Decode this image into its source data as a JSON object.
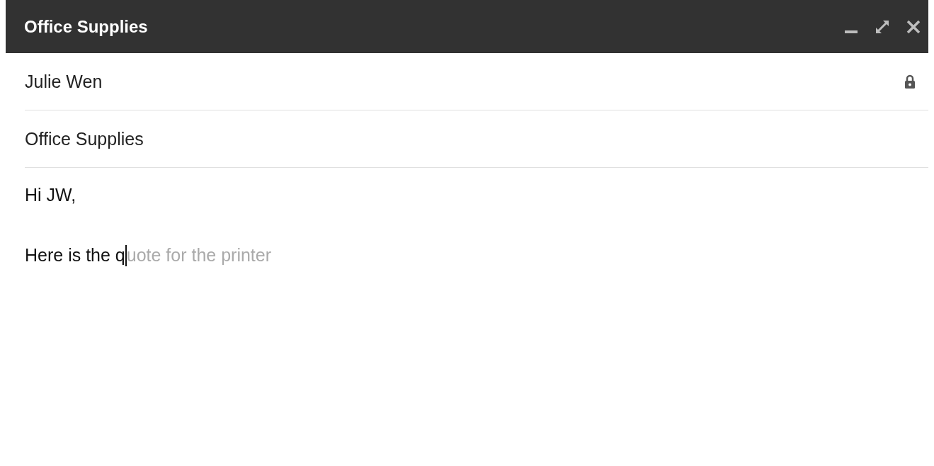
{
  "window": {
    "title": "Office Supplies",
    "controls": [
      {
        "kind": "minimize"
      },
      {
        "kind": "expand"
      },
      {
        "kind": "close"
      }
    ]
  },
  "recipients": {
    "value": "Julie Wen",
    "locked": true
  },
  "subject": {
    "value": "Office Supplies"
  },
  "body": [
    {
      "kind": "text",
      "text": "Hi JW,"
    },
    {
      "kind": "suggest",
      "typed": "Here is the q",
      "suggestion": "uote for the printer"
    }
  ]
}
